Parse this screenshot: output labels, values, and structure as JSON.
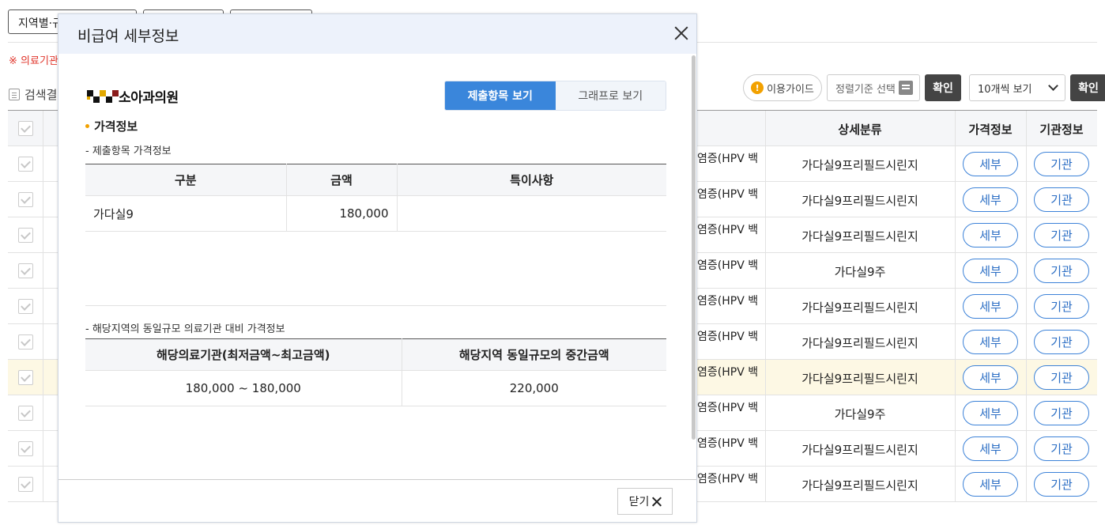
{
  "background": {
    "filters": [
      "지역별·규",
      "",
      ""
    ],
    "notice": "※ 의료기관",
    "result_label": "검색결",
    "guide_label": "이용가이드",
    "sort_label": "정렬기준 선택",
    "confirm_label": "확인",
    "per_page_label": "10개씩 보기",
    "headers": {
      "category": "상세분류",
      "price": "가격정보",
      "institution": "기관정보"
    },
    "rows": [
      {
        "name": "염증(HPV 백",
        "category": "가다실9프리필드시린지",
        "price_btn": "세부",
        "inst_btn": "기관",
        "highlight": false
      },
      {
        "name": "염증(HPV 백",
        "category": "가다실9프리필드시린지",
        "price_btn": "세부",
        "inst_btn": "기관",
        "highlight": false
      },
      {
        "name": "염증(HPV 백",
        "category": "가다실9프리필드시린지",
        "price_btn": "세부",
        "inst_btn": "기관",
        "highlight": false
      },
      {
        "name": "염증(HPV 백",
        "category": "가다실9주",
        "price_btn": "세부",
        "inst_btn": "기관",
        "highlight": false
      },
      {
        "name": "염증(HPV 백",
        "category": "가다실9프리필드시린지",
        "price_btn": "세부",
        "inst_btn": "기관",
        "highlight": false
      },
      {
        "name": "염증(HPV 백",
        "category": "가다실9프리필드시린지",
        "price_btn": "세부",
        "inst_btn": "기관",
        "highlight": false
      },
      {
        "name": "염증(HPV 백",
        "category": "가다실9프리필드시린지",
        "price_btn": "세부",
        "inst_btn": "기관",
        "highlight": true
      },
      {
        "name": "염증(HPV 백",
        "category": "가다실9주",
        "price_btn": "세부",
        "inst_btn": "기관",
        "highlight": false
      },
      {
        "name": "염증(HPV 백",
        "category": "가다실9프리필드시린지",
        "price_btn": "세부",
        "inst_btn": "기관",
        "highlight": false
      },
      {
        "name": "염증(HPV 백",
        "category": "가다실9프리필드시린지",
        "price_btn": "세부",
        "inst_btn": "기관",
        "highlight": false
      }
    ]
  },
  "modal": {
    "title": "비급여 세부정보",
    "hospital_name": "소아과의원",
    "tabs": [
      {
        "label": "제출항목 보기",
        "active": true
      },
      {
        "label": "그래프로 보기",
        "active": false
      }
    ],
    "section_title": "가격정보",
    "submitted": {
      "subtitle": "- 제출항목 가격정보",
      "headers": [
        "구분",
        "금액",
        "특이사항"
      ],
      "rows": [
        {
          "item": "가다실9",
          "amount": "180,000",
          "note": ""
        }
      ]
    },
    "regional": {
      "subtitle": "- 해당지역의 동일규모 의료기관 대비 가격정보",
      "headers": [
        "해당의료기관(최저금액~최고금액)",
        "해당지역 동일규모의 중간금액"
      ],
      "range": "180,000 ~ 180,000",
      "median": "220,000"
    },
    "close_label": "닫기"
  },
  "colors": {
    "accent": "#3a86db",
    "pill_border": "#3c82d8",
    "highlight_row": "#fdf8e4",
    "warning_dot": "#f2a100",
    "notice": "#e0352b"
  }
}
